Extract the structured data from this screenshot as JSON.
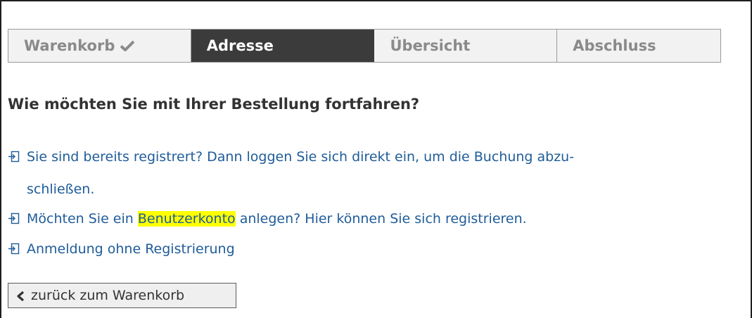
{
  "steps": [
    {
      "label": "Warenkorb",
      "state": "done"
    },
    {
      "label": "Adresse",
      "state": "active"
    },
    {
      "label": "Übersicht",
      "state": "pending"
    },
    {
      "label": "Abschluss",
      "state": "pending"
    }
  ],
  "heading": "Wie möchten Sie mit Ihrer Bestellung fortfahren?",
  "options": {
    "login_line1": "Sie sind bereits registrert? Dann loggen Sie sich direkt ein, um die Buchung abzu-",
    "login_line2": "schließen.",
    "register_before": "Möchten Sie ein ",
    "register_highlight": "Benutzerkonto",
    "register_after": " anlegen? Hier können Sie sich registrieren.",
    "guest": "Anmeldung ohne Registrierung"
  },
  "back_button": {
    "label": "zurück zum Warenkorb"
  },
  "colors": {
    "link": "#1f5c99",
    "active_step_bg": "#3b3b3b",
    "highlight": "#ffff00"
  }
}
